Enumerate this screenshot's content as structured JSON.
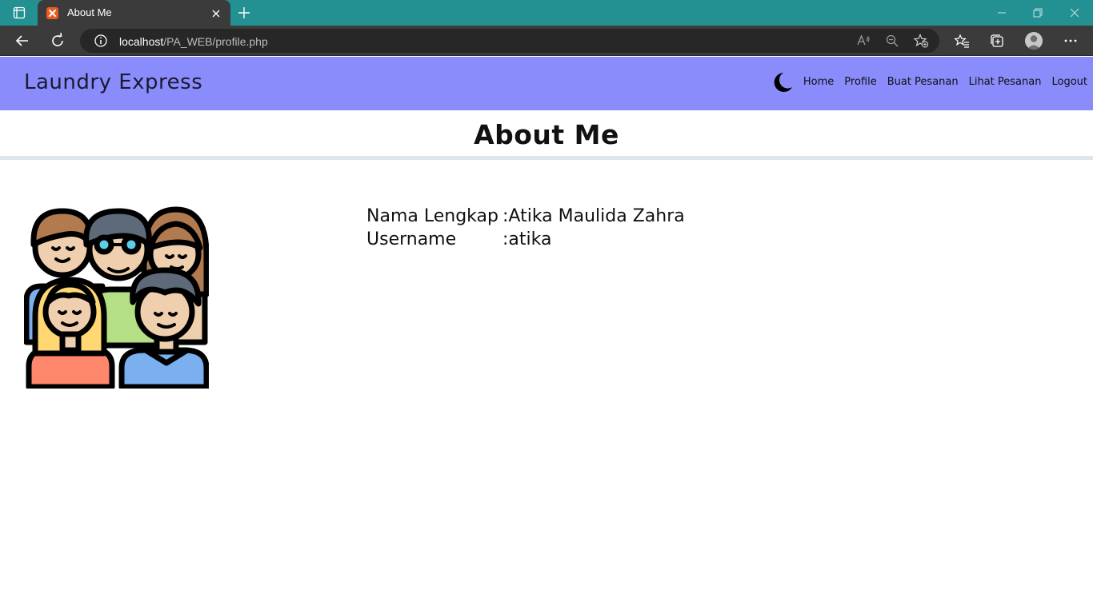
{
  "browser": {
    "tab_title": "About Me",
    "url_host": "localhost",
    "url_path": "/PA_WEB/profile.php"
  },
  "navbar": {
    "brand": "Laundry Express",
    "theme_toggle_icon": "moon-icon",
    "links": [
      "Home",
      "Profile",
      "Buat Pesanan",
      "Lihat Pesanan",
      "Logout"
    ]
  },
  "page": {
    "title": "About Me"
  },
  "profile": {
    "image_icon": "group-of-people-illustration",
    "fields": [
      {
        "label": "Nama Lengkap",
        "value": ":Atika Maulida Zahra"
      },
      {
        "label": "Username",
        "value": ":atika"
      }
    ]
  },
  "colors": {
    "titlebar": "#239092",
    "navbar": "#8b8cfc",
    "header_border": "#dde6ea"
  }
}
